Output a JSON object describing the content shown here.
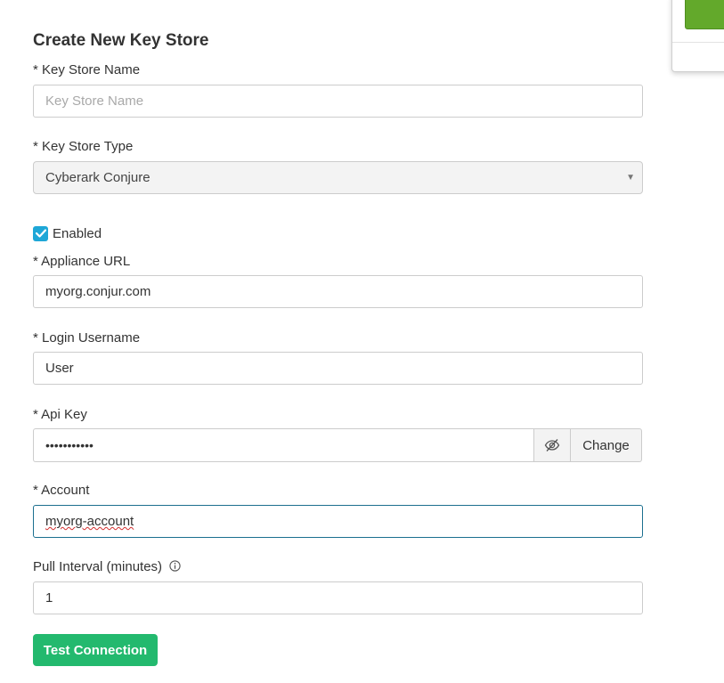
{
  "form": {
    "title": "Create New Key Store",
    "key_store_name": {
      "label": "* Key Store Name",
      "placeholder": "Key Store Name",
      "value": ""
    },
    "key_store_type": {
      "label": "* Key Store Type",
      "selected": "Cyberark Conjure",
      "caret_icon": "caret-down-icon"
    },
    "enabled": {
      "label": "Enabled",
      "checked": true
    },
    "appliance_url": {
      "label": "* Appliance URL",
      "value": "myorg.conjur.com"
    },
    "login_username": {
      "label": "* Login Username",
      "value": "User"
    },
    "api_key": {
      "label": "* Api Key",
      "masked_value": "•••••••••••",
      "toggle_icon": "eye-slash-icon",
      "change_label": "Change"
    },
    "account": {
      "label": "* Account",
      "value": "myorg-account"
    },
    "pull_interval": {
      "label": "Pull Interval (minutes)",
      "info_icon": "info-icon",
      "value": "1"
    },
    "test_connection_label": "Test Connection"
  },
  "colors": {
    "primary_green": "#23b96e",
    "checkbox_blue": "#1ea7d7",
    "focus_border": "#1b6f8f",
    "panel_green": "#63a92b"
  }
}
